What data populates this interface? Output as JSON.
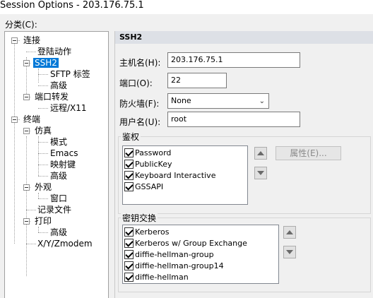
{
  "window": {
    "title": "Session Options - 203.176.75.1"
  },
  "tree": {
    "label": "分类(C):",
    "items": [
      "连接",
      "登陆动作",
      "SSH2",
      "SFTP 标签",
      "高级",
      "端口转发",
      "远程/X11",
      "终端",
      "仿真",
      "模式",
      "Emacs",
      "映射键",
      "高级",
      "外观",
      "窗口",
      "记录文件",
      "打印",
      "高级",
      "X/Y/Zmodem"
    ],
    "selected": "SSH2"
  },
  "panel": {
    "header": "SSH2",
    "hostname_label": "主机名(H):",
    "hostname_value": "203.176.75.1",
    "port_label": "端口(O):",
    "port_value": "22",
    "firewall_label": "防火墙(F):",
    "firewall_value": "None",
    "username_label": "用户名(U):",
    "username_value": "root",
    "auth": {
      "title": "鉴权",
      "items": [
        "Password",
        "PublicKey",
        "Keyboard Interactive",
        "GSSAPI"
      ],
      "properties_button": "属性(E)..."
    },
    "kex": {
      "title": "密钥交换",
      "items": [
        "Kerberos",
        "Kerberos w/ Group Exchange",
        "diffie-hellman-group",
        "diffie-hellman-group14",
        "diffie-hellman"
      ]
    }
  }
}
